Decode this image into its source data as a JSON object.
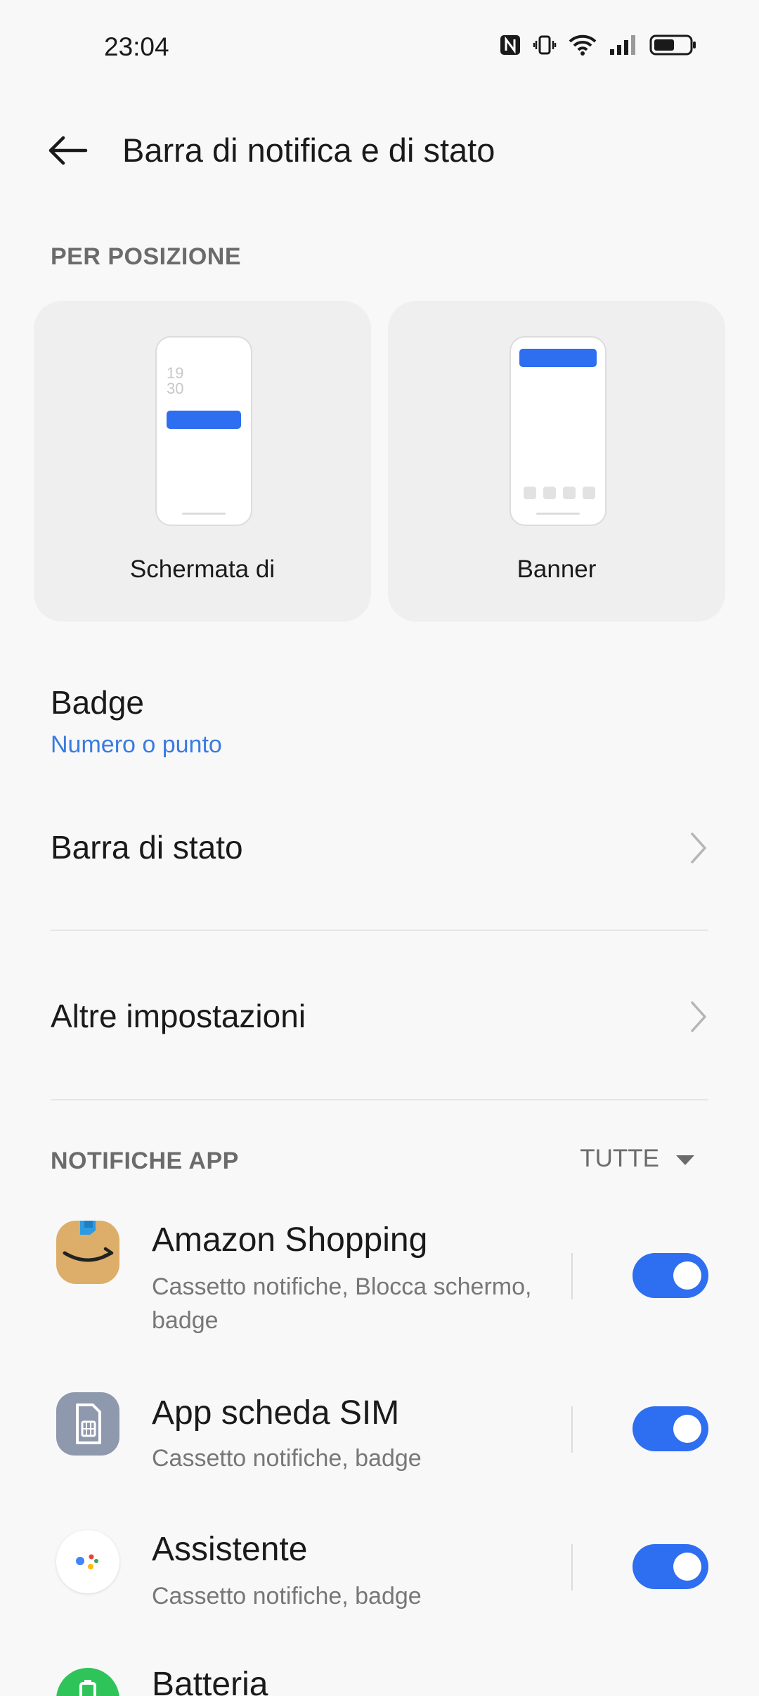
{
  "status_bar": {
    "time": "23:04",
    "icons": [
      "nfc-icon",
      "vibrate-icon",
      "wifi-icon",
      "signal-icon",
      "battery-icon"
    ]
  },
  "header": {
    "title": "Barra di notifica e di stato",
    "back_icon": "arrow-left-icon"
  },
  "position_section": {
    "label": "PER POSIZIONE",
    "cards": [
      {
        "label": "Schermata di",
        "preview_time": [
          "19",
          "30"
        ]
      },
      {
        "label": "Banner"
      }
    ]
  },
  "badge": {
    "title": "Badge",
    "value": "Numero o punto"
  },
  "status_bar_item": {
    "title": "Barra di stato"
  },
  "other_settings": {
    "title": "Altre impostazioni"
  },
  "app_notifications": {
    "label": "NOTIFICHE APP",
    "filter": "TUTTE",
    "apps": [
      {
        "name": "Amazon Shopping",
        "desc": "Cassetto notifiche, Blocca schermo, badge",
        "enabled": true,
        "icon": "amazon-icon"
      },
      {
        "name": "App scheda SIM",
        "desc": "Cassetto notifiche, badge",
        "enabled": true,
        "icon": "sim-card-icon"
      },
      {
        "name": "Assistente",
        "desc": "Cassetto notifiche, badge",
        "enabled": true,
        "icon": "assistant-icon"
      },
      {
        "name": "Batteria",
        "icon": "battery-app-icon"
      }
    ]
  },
  "colors": {
    "accent": "#2e6ef0",
    "link": "#3a7be0",
    "background": "#f8f8f8",
    "card": "#efefef"
  }
}
